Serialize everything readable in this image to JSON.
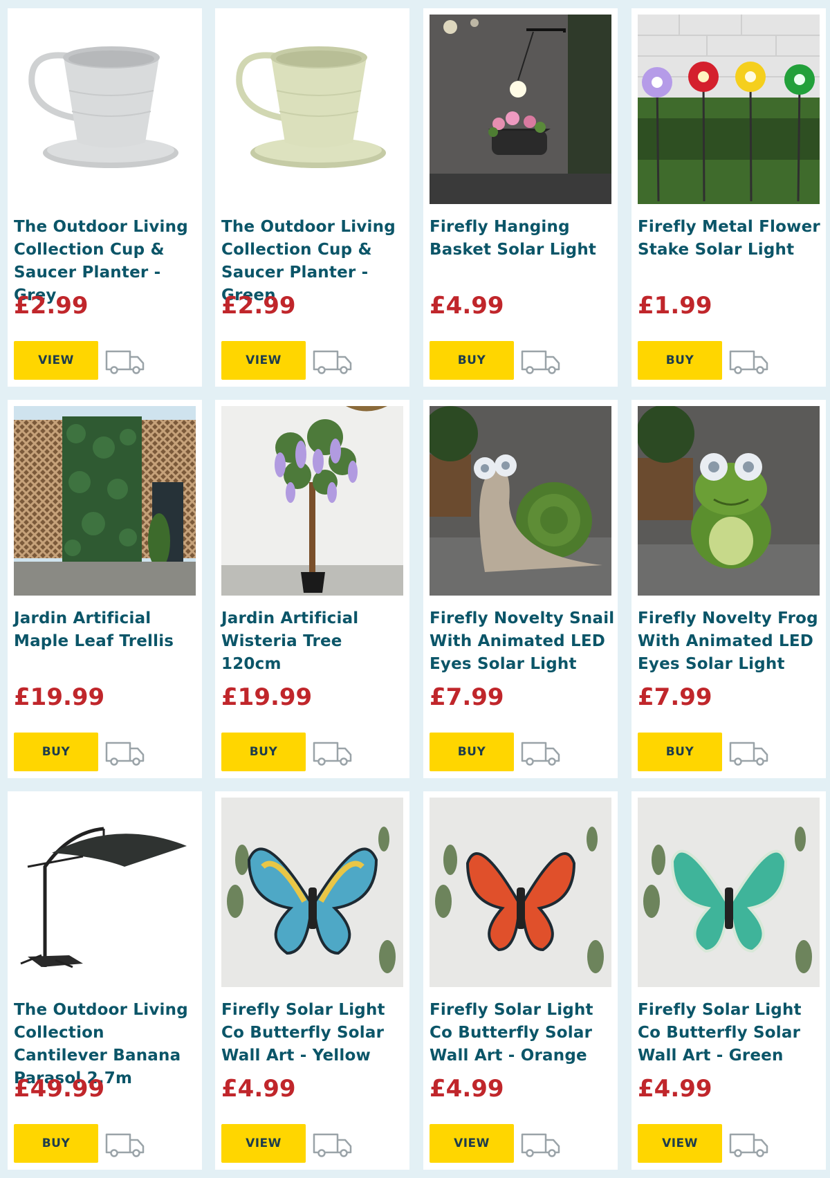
{
  "products": [
    {
      "title": "The Outdoor Living Collection Cup & Saucer Planter - Grey",
      "price": "£2.99",
      "button": "VIEW",
      "image": "grey-cup-planter"
    },
    {
      "title": "The Outdoor Living Collection Cup & Saucer Planter - Green",
      "price": "£2.99",
      "button": "VIEW",
      "image": "green-cup-planter"
    },
    {
      "title": "Firefly Hanging Basket Solar Light",
      "price": "£4.99",
      "button": "BUY",
      "image": "hanging-basket-light"
    },
    {
      "title": "Firefly Metal Flower Stake Solar Light",
      "price": "£1.99",
      "button": "BUY",
      "image": "flower-stake-light"
    },
    {
      "title": "Jardin Artificial Maple Leaf Trellis",
      "price": "£19.99",
      "button": "BUY",
      "image": "maple-trellis"
    },
    {
      "title": "Jardin Artificial Wisteria Tree 120cm",
      "price": "£19.99",
      "button": "BUY",
      "image": "wisteria-tree"
    },
    {
      "title": "Firefly Novelty Snail With Animated LED Eyes Solar Light",
      "price": "£7.99",
      "button": "BUY",
      "image": "snail-light"
    },
    {
      "title": "Firefly Novelty Frog With Animated LED Eyes Solar Light",
      "price": "£7.99",
      "button": "BUY",
      "image": "frog-light"
    },
    {
      "title": "The Outdoor Living Collection Cantilever Banana Parasol 2.7m",
      "price": "£49.99",
      "button": "BUY",
      "image": "banana-parasol"
    },
    {
      "title": "Firefly Solar Light Co Butterfly Solar Wall Art - Yellow",
      "price": "£4.99",
      "button": "VIEW",
      "image": "butterfly-yellow"
    },
    {
      "title": "Firefly Solar Light Co Butterfly Solar Wall Art - Orange",
      "price": "£4.99",
      "button": "VIEW",
      "image": "butterfly-orange"
    },
    {
      "title": "Firefly Solar Light Co Butterfly Solar Wall Art - Green",
      "price": "£4.99",
      "button": "VIEW",
      "image": "butterfly-green"
    }
  ],
  "colors": {
    "background": "#e3f0f5",
    "title": "#0b5568",
    "price": "#c0262b",
    "button": "#ffd600"
  },
  "icons": {
    "delivery": "delivery-van-icon"
  }
}
